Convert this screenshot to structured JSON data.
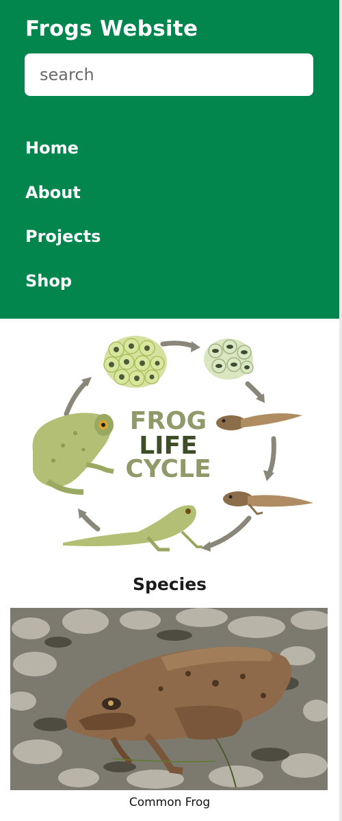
{
  "site": {
    "title": "Frogs Website"
  },
  "search": {
    "placeholder": "search"
  },
  "nav": {
    "items": [
      {
        "label": "Home"
      },
      {
        "label": "About"
      },
      {
        "label": "Projects"
      },
      {
        "label": "Shop"
      }
    ]
  },
  "lifecycle": {
    "line1": "FROG",
    "line2": "LIFE",
    "line3": "CYCLE"
  },
  "species": {
    "heading": "Species",
    "caption": "Common Frog"
  },
  "colors": {
    "header_bg": "#03854e",
    "header_text": "#ffffff",
    "frog_green": "#a9b86a",
    "arrow_gray": "#8a877a"
  }
}
